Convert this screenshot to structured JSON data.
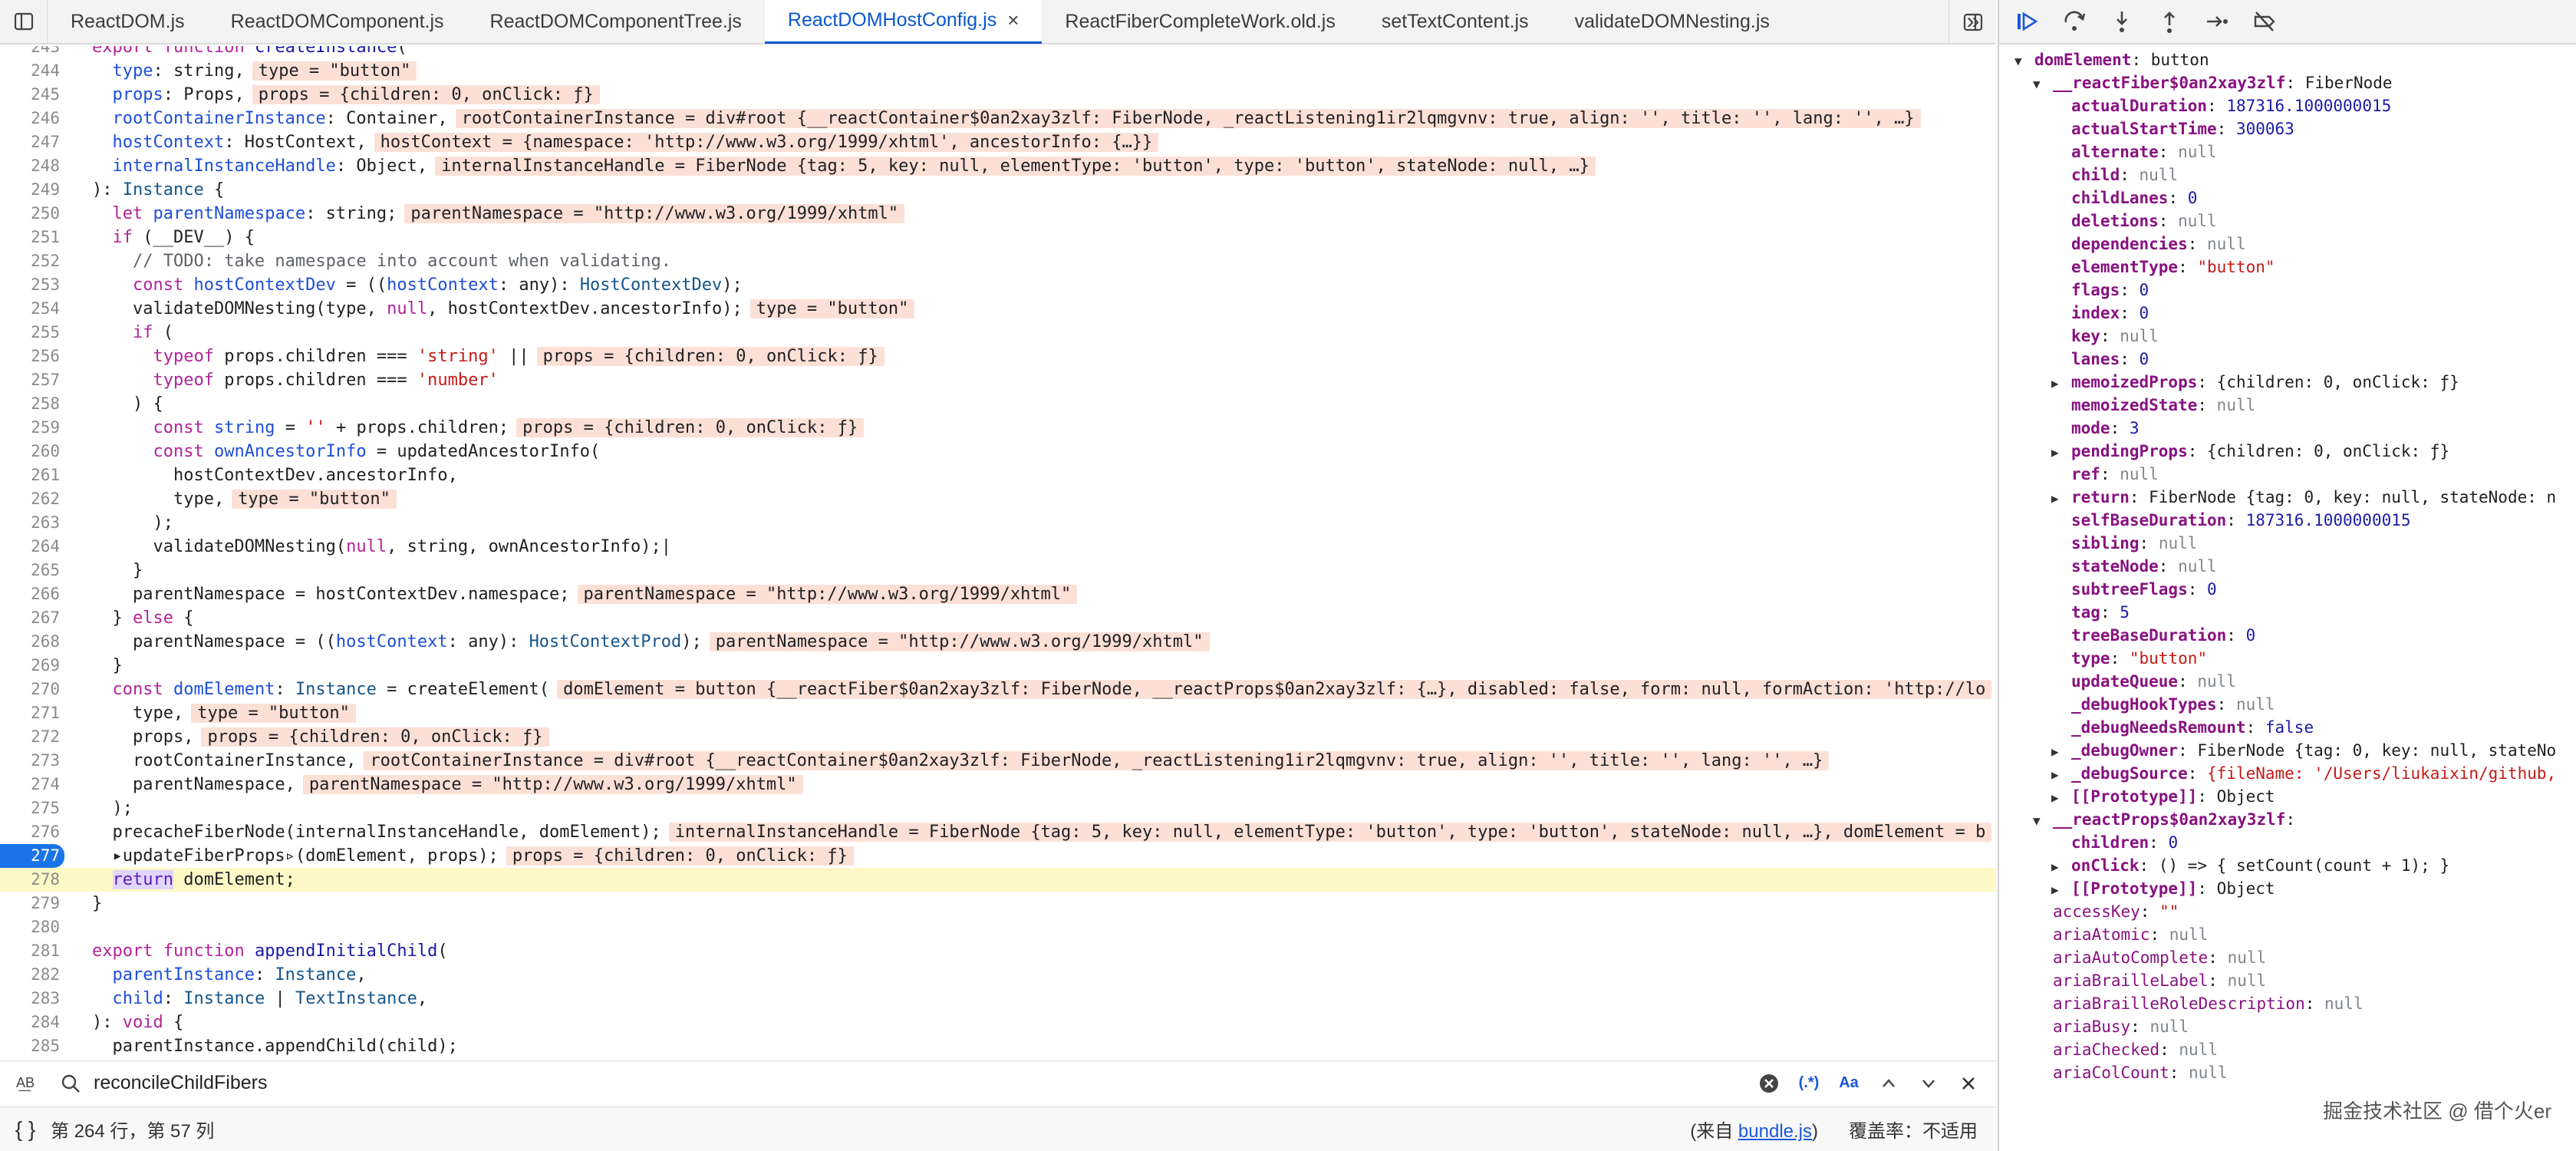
{
  "tabs": [
    {
      "label": "ReactDOM.js",
      "active": false
    },
    {
      "label": "ReactDOMComponent.js",
      "active": false
    },
    {
      "label": "ReactDOMComponentTree.js",
      "active": false
    },
    {
      "label": "ReactDOMHostConfig.js",
      "active": true,
      "close": "×"
    },
    {
      "label": "ReactFiberCompleteWork.old.js",
      "active": false
    },
    {
      "label": "setTextContent.js",
      "active": false
    },
    {
      "label": "validateDOMNesting.js",
      "active": false
    }
  ],
  "more_tabs": "»",
  "code_lines": [
    {
      "n": "243",
      "html": "<span class='kw'>export</span> <span class='kw'>function</span> <span class='fn'>createInstance</span>(",
      "val": ""
    },
    {
      "n": "244",
      "html": "  <span class='pm'>type</span>: string,",
      "val": "type = \"button\""
    },
    {
      "n": "245",
      "html": "  <span class='pm'>props</span>: Props,",
      "val": "props = {children: 0, onClick: ƒ}"
    },
    {
      "n": "246",
      "html": "  <span class='pm'>rootContainerInstance</span>: Container,",
      "val": "rootContainerInstance = div#root {__reactContainer$0an2xay3zlf: FiberNode, _reactListening1ir2lqmgvnv: true, align: '', title: '', lang: '', …}"
    },
    {
      "n": "247",
      "html": "  <span class='pm'>hostContext</span>: HostContext,",
      "val": "hostContext = {namespace: 'http://www.w3.org/1999/xhtml', ancestorInfo: {…}}"
    },
    {
      "n": "248",
      "html": "  <span class='pm'>internalInstanceHandle</span>: Object,",
      "val": "internalInstanceHandle = FiberNode {tag: 5, key: null, elementType: 'button', type: 'button', stateNode: null, …}"
    },
    {
      "n": "249",
      "html": "): <span class='ty'>Instance</span> {",
      "val": ""
    },
    {
      "n": "250",
      "html": "  <span class='kw'>let</span> <span class='pm'>parentNamespace</span>: string;",
      "val": "parentNamespace = \"http://www.w3.org/1999/xhtml\""
    },
    {
      "n": "251",
      "html": "  <span class='kw'>if</span> (__DEV__) {",
      "val": ""
    },
    {
      "n": "252",
      "html": "    <span class='cm'>// TODO: take namespace into account when validating.</span>",
      "val": ""
    },
    {
      "n": "253",
      "html": "    <span class='kw'>const</span> <span class='pm'>hostContextDev</span> = ((<span class='pm'>hostContext</span>: any): <span class='ty'>HostContextDev</span>);",
      "val": ""
    },
    {
      "n": "254",
      "html": "    validateDOMNesting(type, <span class='kw'>null</span>, hostContextDev.ancestorInfo);",
      "val": "type = \"button\""
    },
    {
      "n": "255",
      "html": "    <span class='kw'>if</span> (",
      "val": ""
    },
    {
      "n": "256",
      "html": "      <span class='kw'>typeof</span> props.children === <span class='st'>'string'</span> ||",
      "val": "props = {children: 0, onClick: ƒ}"
    },
    {
      "n": "257",
      "html": "      <span class='kw'>typeof</span> props.children === <span class='st'>'number'</span>",
      "val": ""
    },
    {
      "n": "258",
      "html": "    ) {",
      "val": ""
    },
    {
      "n": "259",
      "html": "      <span class='kw'>const</span> <span class='pm'>string</span> = <span class='st'>''</span> + props.children;",
      "val": "props = {children: 0, onClick: ƒ}"
    },
    {
      "n": "260",
      "html": "      <span class='kw'>const</span> <span class='pm'>ownAncestorInfo</span> = updatedAncestorInfo(",
      "val": ""
    },
    {
      "n": "261",
      "html": "        hostContextDev.ancestorInfo,",
      "val": ""
    },
    {
      "n": "262",
      "html": "        type,",
      "val": "type = \"button\""
    },
    {
      "n": "263",
      "html": "      );",
      "val": ""
    },
    {
      "n": "264",
      "html": "      validateDOMNesting(<span class='kw'>null</span>, string, ownAncestorInfo);|",
      "val": ""
    },
    {
      "n": "265",
      "html": "    }",
      "val": ""
    },
    {
      "n": "266",
      "html": "    parentNamespace = hostContextDev.namespace;",
      "val": "parentNamespace = \"http://www.w3.org/1999/xhtml\""
    },
    {
      "n": "267",
      "html": "  } <span class='kw'>else</span> {",
      "val": ""
    },
    {
      "n": "268",
      "html": "    parentNamespace = ((<span class='pm'>hostContext</span>: any): <span class='ty'>HostContextProd</span>);",
      "val": "parentNamespace = \"http://www.w3.org/1999/xhtml\""
    },
    {
      "n": "269",
      "html": "  }",
      "val": ""
    },
    {
      "n": "270",
      "html": "  <span class='kw'>const</span> <span class='pm'>domElement</span>: <span class='ty'>Instance</span> = createElement(",
      "val": "domElement = button {__reactFiber$0an2xay3zlf: FiberNode, __reactProps$0an2xay3zlf: {…}, disabled: false, form: null, formAction: 'http://lo"
    },
    {
      "n": "271",
      "html": "    type,",
      "val": "type = \"button\""
    },
    {
      "n": "272",
      "html": "    props,",
      "val": "props = {children: 0, onClick: ƒ}"
    },
    {
      "n": "273",
      "html": "    rootContainerInstance,",
      "val": "rootContainerInstance = div#root {__reactContainer$0an2xay3zlf: FiberNode, _reactListening1ir2lqmgvnv: true, align: '', title: '', lang: '', …}"
    },
    {
      "n": "274",
      "html": "    parentNamespace,",
      "val": "parentNamespace = \"http://www.w3.org/1999/xhtml\""
    },
    {
      "n": "275",
      "html": "  );",
      "val": ""
    },
    {
      "n": "276",
      "html": "  precacheFiberNode(internalInstanceHandle, domElement);",
      "val": "internalInstanceHandle = FiberNode {tag: 5, key: null, elementType: 'button', type: 'button', stateNode: null, …}, domElement = b"
    },
    {
      "n": "277",
      "html": "  ▸updateFiberProps▹(domElement, props);",
      "val": "props = {children: 0, onClick: ƒ}",
      "bp": true
    },
    {
      "n": "278",
      "html": "  <span class='ret'>return</span> domElement;",
      "val": "",
      "current": true
    },
    {
      "n": "279",
      "html": "}",
      "val": ""
    },
    {
      "n": "280",
      "html": "",
      "val": ""
    },
    {
      "n": "281",
      "html": "<span class='kw'>export</span> <span class='kw'>function</span> <span class='fn'>appendInitialChild</span>(",
      "val": ""
    },
    {
      "n": "282",
      "html": "  <span class='pm'>parentInstance</span>: <span class='ty'>Instance</span>,",
      "val": ""
    },
    {
      "n": "283",
      "html": "  <span class='pm'>child</span>: <span class='ty'>Instance</span> | <span class='ty'>TextInstance</span>,",
      "val": ""
    },
    {
      "n": "284",
      "html": "): <span class='kw'>void</span> {",
      "val": ""
    },
    {
      "n": "285",
      "html": "  parentInstance.appendChild(child);",
      "val": ""
    }
  ],
  "search": {
    "value": "reconcileChildFibers",
    "regex_label": "(.*)",
    "case_label": "Aa",
    "aa_label": "A͟B"
  },
  "status": {
    "position": "第 264 行，第 57 列",
    "source_prefix": "(来自 ",
    "source_link": "bundle.js",
    "source_suffix": ")",
    "coverage": "覆盖率：不适用"
  },
  "scope_rows": [
    {
      "indent": 0,
      "arrow": "▼",
      "key": "domElement",
      "sep": ": ",
      "value": "button",
      "vt": "plain"
    },
    {
      "indent": 1,
      "arrow": "▼",
      "key": "__reactFiber$0an2xay3zlf",
      "sep": ": ",
      "value": "FiberNode",
      "vt": "plain"
    },
    {
      "indent": 2,
      "arrow": "",
      "key": "actualDuration",
      "sep": ": ",
      "value": "187316.1000000015",
      "vt": "num"
    },
    {
      "indent": 2,
      "arrow": "",
      "key": "actualStartTime",
      "sep": ": ",
      "value": "300063",
      "vt": "num"
    },
    {
      "indent": 2,
      "arrow": "",
      "key": "alternate",
      "sep": ": ",
      "value": "null",
      "vt": "nul"
    },
    {
      "indent": 2,
      "arrow": "",
      "key": "child",
      "sep": ": ",
      "value": "null",
      "vt": "nul"
    },
    {
      "indent": 2,
      "arrow": "",
      "key": "childLanes",
      "sep": ": ",
      "value": "0",
      "vt": "num"
    },
    {
      "indent": 2,
      "arrow": "",
      "key": "deletions",
      "sep": ": ",
      "value": "null",
      "vt": "nul"
    },
    {
      "indent": 2,
      "arrow": "",
      "key": "dependencies",
      "sep": ": ",
      "value": "null",
      "vt": "nul"
    },
    {
      "indent": 2,
      "arrow": "",
      "key": "elementType",
      "sep": ": ",
      "value": "\"button\"",
      "vt": "str"
    },
    {
      "indent": 2,
      "arrow": "",
      "key": "flags",
      "sep": ": ",
      "value": "0",
      "vt": "num"
    },
    {
      "indent": 2,
      "arrow": "",
      "key": "index",
      "sep": ": ",
      "value": "0",
      "vt": "num"
    },
    {
      "indent": 2,
      "arrow": "",
      "key": "key",
      "sep": ": ",
      "value": "null",
      "vt": "nul"
    },
    {
      "indent": 2,
      "arrow": "",
      "key": "lanes",
      "sep": ": ",
      "value": "0",
      "vt": "num"
    },
    {
      "indent": 2,
      "arrow": "▶",
      "key": "memoizedProps",
      "sep": ": ",
      "value": "{children: 0, onClick: ƒ}",
      "vt": "plain"
    },
    {
      "indent": 2,
      "arrow": "",
      "key": "memoizedState",
      "sep": ": ",
      "value": "null",
      "vt": "nul"
    },
    {
      "indent": 2,
      "arrow": "",
      "key": "mode",
      "sep": ": ",
      "value": "3",
      "vt": "num"
    },
    {
      "indent": 2,
      "arrow": "▶",
      "key": "pendingProps",
      "sep": ": ",
      "value": "{children: 0, onClick: ƒ}",
      "vt": "plain"
    },
    {
      "indent": 2,
      "arrow": "",
      "key": "ref",
      "sep": ": ",
      "value": "null",
      "vt": "nul"
    },
    {
      "indent": 2,
      "arrow": "▶",
      "key": "return",
      "sep": ": ",
      "value": "FiberNode {tag: 0, key: null, stateNode: n",
      "vt": "plain"
    },
    {
      "indent": 2,
      "arrow": "",
      "key": "selfBaseDuration",
      "sep": ": ",
      "value": "187316.1000000015",
      "vt": "num"
    },
    {
      "indent": 2,
      "arrow": "",
      "key": "sibling",
      "sep": ": ",
      "value": "null",
      "vt": "nul"
    },
    {
      "indent": 2,
      "arrow": "",
      "key": "stateNode",
      "sep": ": ",
      "value": "null",
      "vt": "nul"
    },
    {
      "indent": 2,
      "arrow": "",
      "key": "subtreeFlags",
      "sep": ": ",
      "value": "0",
      "vt": "num"
    },
    {
      "indent": 2,
      "arrow": "",
      "key": "tag",
      "sep": ": ",
      "value": "5",
      "vt": "num"
    },
    {
      "indent": 2,
      "arrow": "",
      "key": "treeBaseDuration",
      "sep": ": ",
      "value": "0",
      "vt": "num"
    },
    {
      "indent": 2,
      "arrow": "",
      "key": "type",
      "sep": ": ",
      "value": "\"button\"",
      "vt": "str"
    },
    {
      "indent": 2,
      "arrow": "",
      "key": "updateQueue",
      "sep": ": ",
      "value": "null",
      "vt": "nul"
    },
    {
      "indent": 2,
      "arrow": "",
      "key": "_debugHookTypes",
      "sep": ": ",
      "value": "null",
      "vt": "nul"
    },
    {
      "indent": 2,
      "arrow": "",
      "key": "_debugNeedsRemount",
      "sep": ": ",
      "value": "false",
      "vt": "num"
    },
    {
      "indent": 2,
      "arrow": "▶",
      "key": "_debugOwner",
      "sep": ": ",
      "value": "FiberNode {tag: 0, key: null, stateNo",
      "vt": "plain"
    },
    {
      "indent": 2,
      "arrow": "▶",
      "key": "_debugSource",
      "sep": ": ",
      "value": "{fileName: '/Users/liukaixin/github,",
      "vt": "str"
    },
    {
      "indent": 2,
      "arrow": "▶",
      "key": "[[Prototype]]",
      "sep": ": ",
      "value": "Object",
      "vt": "proto"
    },
    {
      "indent": 1,
      "arrow": "▼",
      "key": "__reactProps$0an2xay3zlf",
      "sep": ":",
      "value": "",
      "vt": "plain"
    },
    {
      "indent": 2,
      "arrow": "",
      "key": "children",
      "sep": ": ",
      "value": "0",
      "vt": "num"
    },
    {
      "indent": 2,
      "arrow": "▶",
      "key": "onClick",
      "sep": ": ",
      "value": "() => { setCount(count + 1); }",
      "vt": "plain"
    },
    {
      "indent": 2,
      "arrow": "▶",
      "key": "[[Prototype]]",
      "sep": ": ",
      "value": "Object",
      "vt": "proto"
    },
    {
      "indent": 1,
      "arrow": "",
      "key": "accessKey",
      "sep": ": ",
      "value": "\"\"",
      "vt": "str"
    },
    {
      "indent": 1,
      "arrow": "",
      "key": "ariaAtomic",
      "sep": ": ",
      "value": "null",
      "vt": "nul"
    },
    {
      "indent": 1,
      "arrow": "",
      "key": "ariaAutoComplete",
      "sep": ": ",
      "value": "null",
      "vt": "nul"
    },
    {
      "indent": 1,
      "arrow": "",
      "key": "ariaBrailleLabel",
      "sep": ": ",
      "value": "null",
      "vt": "nul"
    },
    {
      "indent": 1,
      "arrow": "",
      "key": "ariaBrailleRoleDescription",
      "sep": ": ",
      "value": "null",
      "vt": "nul"
    },
    {
      "indent": 1,
      "arrow": "",
      "key": "ariaBusy",
      "sep": ": ",
      "value": "null",
      "vt": "nul"
    },
    {
      "indent": 1,
      "arrow": "",
      "key": "ariaChecked",
      "sep": ": ",
      "value": "null",
      "vt": "nul"
    },
    {
      "indent": 1,
      "arrow": "",
      "key": "ariaColCount",
      "sep": ": ",
      "value": "null",
      "vt": "nul"
    }
  ],
  "watermark": "掘金技术社区 @ 借个火er",
  "colors": {
    "accent": "#0b57d0",
    "current_line": "#fdf8c6",
    "inline_value": "#fce0d6",
    "breakpoint": "#1a73e8"
  }
}
